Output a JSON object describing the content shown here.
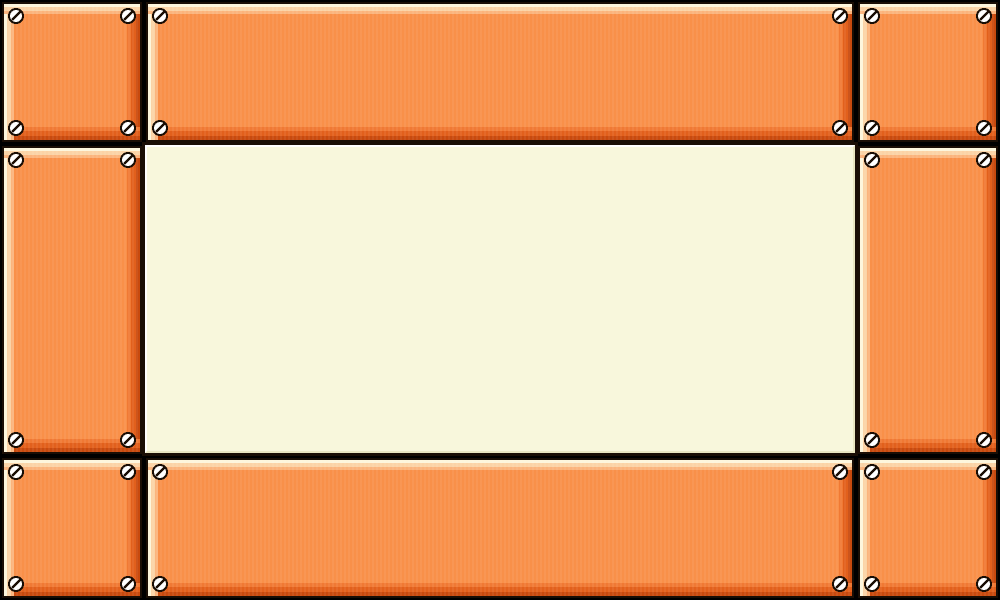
{
  "scene": "ui-frame",
  "colors": {
    "plate_fill": "#f99049",
    "plate_highlight": "#fdf6dc",
    "plate_shadow": "#c94a0e",
    "outline": "#1a0e05",
    "panel_fill": "#f8f7dc",
    "bolt_fill": "#ffffff"
  },
  "plates": [
    {
      "name": "corner-plate-top-left",
      "icon": "bolt-icon"
    },
    {
      "name": "edge-plate-top",
      "icon": "bolt-icon"
    },
    {
      "name": "corner-plate-top-right",
      "icon": "bolt-icon"
    },
    {
      "name": "edge-plate-left",
      "icon": "bolt-icon"
    },
    {
      "name": "edge-plate-right",
      "icon": "bolt-icon"
    },
    {
      "name": "corner-plate-bottom-left",
      "icon": "bolt-icon"
    },
    {
      "name": "edge-plate-bottom",
      "icon": "bolt-icon"
    },
    {
      "name": "corner-plate-bottom-right",
      "icon": "bolt-icon"
    }
  ],
  "center_panel": {
    "text": ""
  }
}
